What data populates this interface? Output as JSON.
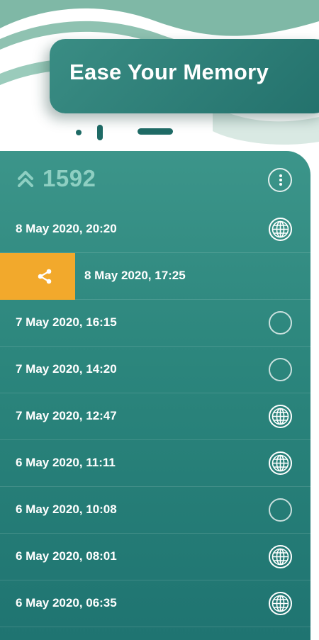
{
  "banner": {
    "title": "Ease Your Memory"
  },
  "header": {
    "icon": "double-chevron-up-icon",
    "count": "1592",
    "menu_icon": "more-vertical-icon"
  },
  "colors": {
    "accent": "#f2a92c",
    "screen_top": "#3c958a",
    "screen_bottom": "#1f7471",
    "banner": "#2f7f78"
  },
  "entries": [
    {
      "label": "8 May 2020, 20:20",
      "icon": "globe-icon"
    },
    {
      "label": "8 May 2020, 17:25",
      "action": "share-icon"
    },
    {
      "label": "7 May 2020, 16:15",
      "icon": "circle-icon"
    },
    {
      "label": "7 May 2020, 14:20",
      "icon": "circle-icon"
    },
    {
      "label": "7 May 2020, 12:47",
      "icon": "globe-icon"
    },
    {
      "label": "6 May 2020, 11:11",
      "icon": "globe-icon"
    },
    {
      "label": "6 May 2020, 10:08",
      "icon": "circle-icon"
    },
    {
      "label": "6 May 2020, 08:01",
      "icon": "globe-icon"
    },
    {
      "label": "6 May 2020, 06:35",
      "icon": "globe-icon"
    }
  ]
}
